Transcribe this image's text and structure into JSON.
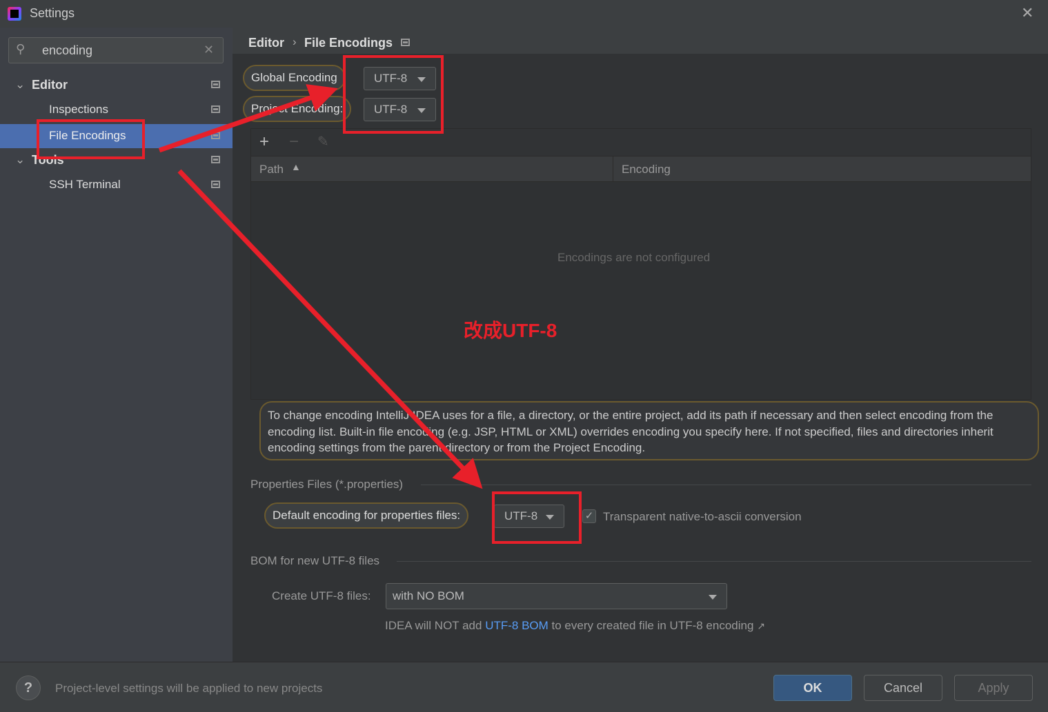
{
  "window": {
    "title": "Settings"
  },
  "search": {
    "value": "encoding"
  },
  "sidebar": {
    "items": [
      {
        "label": "Editor",
        "expanded": true
      },
      {
        "label": "Inspections"
      },
      {
        "label": "File Encodings",
        "selected": true
      },
      {
        "label": "Tools",
        "expanded": true
      },
      {
        "label": "SSH Terminal"
      }
    ]
  },
  "breadcrumb": {
    "parent": "Editor",
    "current": "File Encodings"
  },
  "global": {
    "label": "Global Encoding",
    "value": "UTF-8"
  },
  "project": {
    "label": "Project Encoding:",
    "value": "UTF-8"
  },
  "table": {
    "columns": [
      "Path",
      "Encoding"
    ],
    "empty_text": "Encodings are not configured"
  },
  "help_text": "To change encoding IntelliJ IDEA uses for a file, a directory, or the entire project, add its path if necessary and then select encoding from the encoding list. Built-in file encoding (e.g. JSP, HTML or XML) overrides encoding you specify here. If not specified, files and directories inherit encoding settings from the parent directory or from the Project Encoding.",
  "properties": {
    "section": "Properties Files (*.properties)",
    "label": "Default encoding for properties files:",
    "value": "UTF-8",
    "checkbox_label": "Transparent native-to-ascii conversion",
    "checked": true
  },
  "bom": {
    "section": "BOM for new UTF-8 files",
    "label": "Create UTF-8 files:",
    "value": "with NO BOM",
    "note_pre": "IDEA will NOT add ",
    "note_link": "UTF-8 BOM",
    "note_post": " to every created file in UTF-8 encoding"
  },
  "footer": {
    "help": "?",
    "message": "Project-level settings will be applied to new projects",
    "ok": "OK",
    "cancel": "Cancel",
    "apply": "Apply"
  },
  "annotation": {
    "text": "改成UTF-8",
    "color": "#e8202a"
  },
  "colors": {
    "selection": "#4b6eaf",
    "link": "#589df6",
    "ok": "#365880"
  }
}
